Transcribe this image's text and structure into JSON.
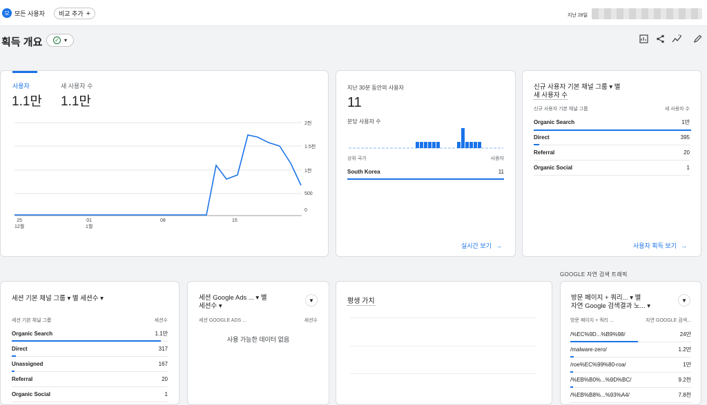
{
  "topbar": {
    "avatar_letter": "모",
    "all_users_label": "모든 사용자",
    "compare_label": "비교 추가",
    "date_label": "지난 28일"
  },
  "page": {
    "title": "획득 개요"
  },
  "users_card": {
    "tabs": [
      {
        "label": "사용자",
        "value": "1.1만"
      },
      {
        "label": "새 사용자 수",
        "value": "1.1만"
      }
    ],
    "yticks": [
      "2천",
      "1.5천",
      "1천",
      "500",
      "0"
    ],
    "xticks": [
      {
        "l1": "25",
        "l2": "12월"
      },
      {
        "l1": "01",
        "l2": "1월"
      },
      {
        "l1": "08",
        "l2": ""
      },
      {
        "l1": "15",
        "l2": ""
      }
    ]
  },
  "realtime_card": {
    "title": "지난 30분 동안의 사용자",
    "value": "11",
    "per_minute_label": "분당 사용자 수",
    "col_country": "상위 국가",
    "col_users": "사용자",
    "rows": [
      {
        "label": "South Korea",
        "value": "11"
      }
    ],
    "link": "실시간 보기"
  },
  "new_users_card": {
    "title_line1": "신규 사용자 기본 채널 그룹 ▾ 별",
    "title_line2": "새 사용자 수",
    "col1": "신규 사용자 기본 채널 그룹",
    "col2": "새 사용자 수",
    "rows": [
      {
        "label": "Organic Search",
        "value": "1만"
      },
      {
        "label": "Direct",
        "value": "395"
      },
      {
        "label": "Referral",
        "value": "20"
      },
      {
        "label": "Organic Social",
        "value": "1"
      }
    ],
    "link": "사용자 획득 보기"
  },
  "sessions_card": {
    "title": "세션 기본 채널 그룹 ▾ 별 세션수 ▾",
    "col1": "세션 기본 채널 그룹",
    "col2": "세션수",
    "rows": [
      {
        "label": "Organic Search",
        "value": "1.1만"
      },
      {
        "label": "Direct",
        "value": "317"
      },
      {
        "label": "Unassigned",
        "value": "167"
      },
      {
        "label": "Referral",
        "value": "20"
      },
      {
        "label": "Organic Social",
        "value": "1"
      }
    ]
  },
  "ads_card": {
    "title_line1": "세션 Google Ads ... ▾ 별",
    "title_line2": "세션수 ▾",
    "col1": "세션 GOOGLE ADS ...",
    "col2": "세션수",
    "empty": "사용 가능한 데이터 없음"
  },
  "ltv_card": {
    "title": "평생 가치"
  },
  "organic_section_label": "GOOGLE 자연 검색 트래픽",
  "organic_card": {
    "title_line1": "방문 페이지 + 쿼리... ▾ 별",
    "title_line2": "자연 Google 검색결과 노... ▾",
    "col1": "방문 페이지 + 쿼리 ...",
    "col2": "자연 GOOGLE 검색...",
    "rows": [
      {
        "label": "/%EC%9D...%B9%98/",
        "value": "24만"
      },
      {
        "label": "/malware-zero/",
        "value": "1.2만"
      },
      {
        "label": "/roe%EC%99%80-roa/",
        "value": "1만"
      },
      {
        "label": "/%EB%B0%...%9D%BC/",
        "value": "9.2천"
      },
      {
        "label": "/%EB%B8%...%93%A4/",
        "value": "7.8천"
      }
    ]
  },
  "colors": {
    "accent": "#1a73e8",
    "success": "#137333"
  }
}
